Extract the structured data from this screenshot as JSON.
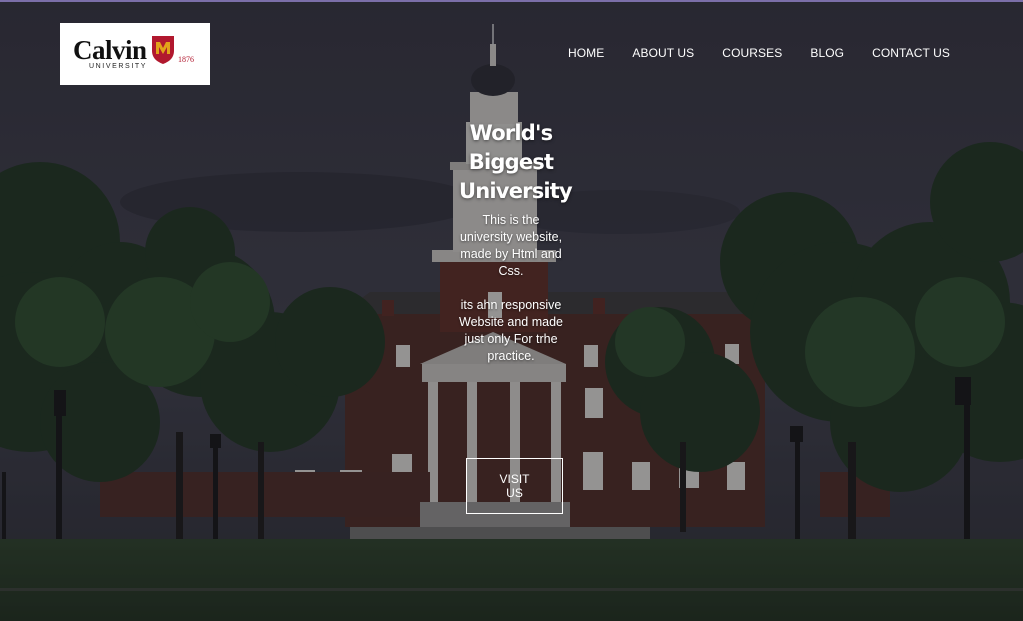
{
  "brand": {
    "name": "Calvin",
    "sub": "UNIVERSITY",
    "year": "1876",
    "accent": "#b1182e",
    "shield_accent": "#e2a21a"
  },
  "nav": {
    "items": [
      {
        "label": "HOME"
      },
      {
        "label": "ABOUT US"
      },
      {
        "label": "COURSES"
      },
      {
        "label": "BLOG"
      },
      {
        "label": "CONTACT US"
      }
    ]
  },
  "hero": {
    "title": "World's Biggest University",
    "para1": "This is the university website, made by Html and Css.",
    "para2": "its ahn responsive Website and made just only For trhe practice.",
    "button": "VISIT US"
  }
}
